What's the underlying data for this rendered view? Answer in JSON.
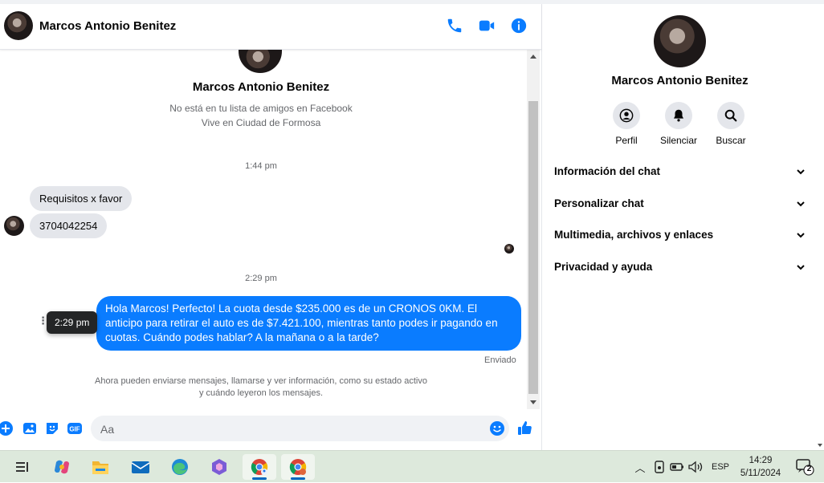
{
  "contact": {
    "name": "Marcos Antonio Benitez",
    "not_friend": "No está en tu lista de amigos en Facebook",
    "lives_in": "Vive en Ciudad de Formosa"
  },
  "header": {
    "icons": [
      "phone-icon",
      "video-icon",
      "info-icon"
    ]
  },
  "messages": {
    "time_1": "1:44 pm",
    "incoming": [
      "Requisitos x favor",
      "3704042254"
    ],
    "time_2": "2:29 pm",
    "outgoing": "Hola Marcos! Perfecto! La cuota desde $235.000 es de un CRONOS 0KM. El anticipo para retirar el auto es de $7.421.100, mientras tanto podes ir pagando en cuotas. Cuándo podes hablar? A la mañana o a la tarde?",
    "tooltip": "2:29 pm",
    "status": "Enviado",
    "notice_line1": "Ahora pueden enviarse mensajes, llamarse y ver información, como su estado activo",
    "notice_line2": "y cuándo leyeron los mensajes."
  },
  "composer": {
    "placeholder": "Aa",
    "gif_label": "GIF"
  },
  "info_panel": {
    "actions": [
      {
        "label": "Perfil",
        "icon": "profile-icon"
      },
      {
        "label": "Silenciar",
        "icon": "bell-icon"
      },
      {
        "label": "Buscar",
        "icon": "search-icon"
      }
    ],
    "sections": [
      "Información del chat",
      "Personalizar chat",
      "Multimedia, archivos y enlaces",
      "Privacidad y ayuda"
    ]
  },
  "taskbar": {
    "language": "ESP",
    "time": "14:29",
    "date": "5/11/2024",
    "notifications": "2"
  },
  "colors": {
    "accent": "#0a7cff",
    "incoming_bubble": "#e4e6eb",
    "taskbar": "#dde9dc"
  }
}
